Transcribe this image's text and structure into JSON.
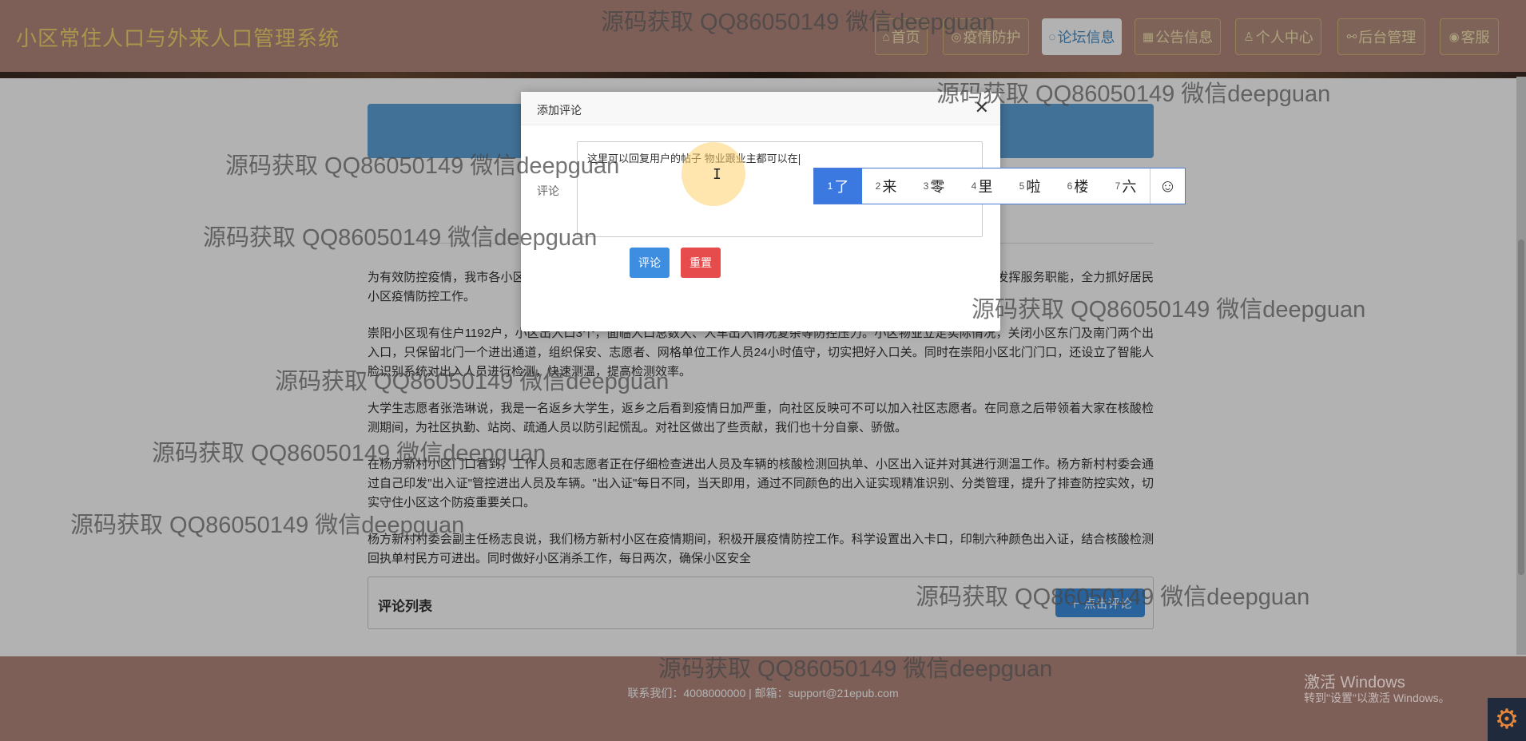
{
  "header": {
    "site_title": "小区常住人口与外来人口管理系统",
    "nav": [
      {
        "icon": "home-icon",
        "glyph": "⌂",
        "label": "首页"
      },
      {
        "icon": "virus-icon",
        "glyph": "◎",
        "label": "疫情防护"
      },
      {
        "icon": "chat-icon",
        "glyph": "◌",
        "label": "论坛信息"
      },
      {
        "icon": "grid-icon",
        "glyph": "▦",
        "label": "公告信息"
      },
      {
        "icon": "user-icon",
        "glyph": "♙",
        "label": "个人中心"
      },
      {
        "icon": "link-icon",
        "glyph": "⚯",
        "label": "后台管理"
      },
      {
        "icon": "support-icon",
        "glyph": "◉",
        "label": "客服"
      }
    ],
    "active_nav": "论坛信息"
  },
  "article": {
    "paragraphs": [
      "为有效防控疫情，我市各小区纷纷行动起来，严格落实疫情防控各项措施，筑牢社区防控第一道防线。各社区组织充分发挥服务职能，全力抓好居民小区疫情防控工作。",
      "崇阳小区现有住户1192户，小区出入口3个，面临人口总数大、人车出入情况复杂等防控压力。小区物业立足实际情况，关闭小区东门及南门两个出入口，只保留北门一个进出通道，组织保安、志愿者、网格单位工作人员24小时值守，切实把好入口关。同时在崇阳小区北门门口，还设立了智能人脸识别系统对出入人员进行检测，快速测温，提高检测效率。",
      "大学生志愿者张浩琳说，我是一名返乡大学生，返乡之后看到疫情日加严重，向社区反映可不可以加入社区志愿者。在同意之后带领着大家在核酸检测期间，为社区执勤、站岗、疏通人员以防引起慌乱。对社区做出了些贡献，我们也十分自豪、骄傲。",
      "在杨方新村小区门口看到，工作人员和志愿者正在仔细检查进出人员及车辆的核酸检测回执单、小区出入证并对其进行测温工作。杨方新村村委会通过自己印发\"出入证\"管控进出人员及车辆。\"出入证\"每日不同，当天即用，通过不同颜色的出入证实现精准识别、分类管理，提升了排查防控实效，切实守住小区这个防疫重要关口。",
      "杨方新村村委会副主任杨志良说，我们杨方新村小区在疫情期间，积极开展疫情防控工作。科学设置出入卡口，印制六种颜色出入证，结合核酸检测回执单村民方可进出。同时做好小区消杀工作，每日两次，确保小区安全"
    ]
  },
  "comments": {
    "title": "评论列表",
    "button_label": "＋ 点击评论"
  },
  "footer": {
    "text": "联系我们：4008000000 | 邮箱：support@21epub.com"
  },
  "modal": {
    "title": "添加评论",
    "close_glyph": "✕",
    "field_label": "评论",
    "textarea_value": "这里可以回复用户的帖子  物业跟业主都可以在",
    "submit_label": "评论",
    "reset_label": "重置"
  },
  "ime": {
    "candidates": [
      {
        "n": "1",
        "c": "了"
      },
      {
        "n": "2",
        "c": "来"
      },
      {
        "n": "3",
        "c": "零"
      },
      {
        "n": "4",
        "c": "里"
      },
      {
        "n": "5",
        "c": "啦"
      },
      {
        "n": "6",
        "c": "楼"
      },
      {
        "n": "7",
        "c": "六"
      }
    ],
    "emoji_glyph": "☺"
  },
  "watermark": {
    "text": "源码获取 QQ86050149 微信deepguan"
  },
  "windows_activation": {
    "line1": "激活 Windows",
    "line2": "转到\"设置\"以激活 Windows。"
  },
  "colors": {
    "header_bg": "#b3897e",
    "title_color": "#f5d76e",
    "accent_blue": "#3d8ee0",
    "reset_red": "#e64c4c",
    "ime_selected": "#3b78e0"
  }
}
